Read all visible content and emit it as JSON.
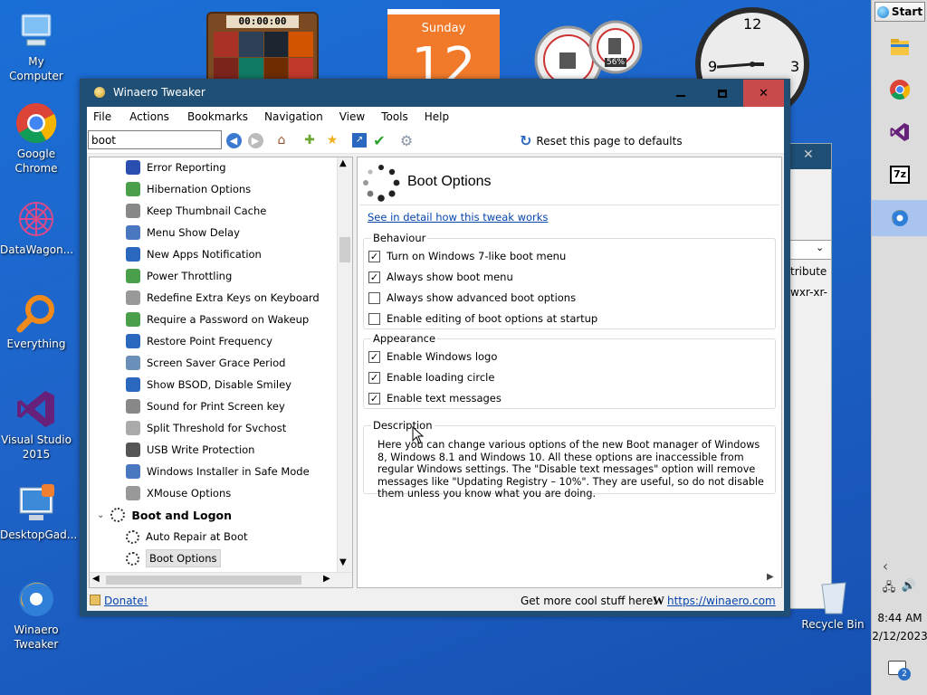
{
  "desktop": {
    "icons": [
      {
        "label": "My Computer"
      },
      {
        "label": "Google Chrome"
      },
      {
        "label": "DataWagon..."
      },
      {
        "label": "Everything"
      },
      {
        "label": "Visual Studio 2015"
      },
      {
        "label": "DesktopGad..."
      },
      {
        "label": "Winaero Tweaker"
      }
    ],
    "recycle_bin": "Recycle Bin"
  },
  "gadgets": {
    "puzzle_timer": "00:00:00",
    "calendar_day": "Sunday",
    "calendar_date": "12",
    "meter_percent": "56%",
    "clock_numbers": [
      "12",
      "3",
      "9"
    ]
  },
  "taskbar": {
    "start_label": "Start",
    "time": "8:44 AM",
    "date": "2/12/2023",
    "notification_count": "2"
  },
  "background_window": {
    "text1": "tribute",
    "text2": "wxr-xr-"
  },
  "window": {
    "title": "Winaero Tweaker",
    "menu": [
      "File",
      "Actions",
      "Bookmarks",
      "Navigation",
      "View",
      "Tools",
      "Help"
    ],
    "search_value": "boot",
    "reset_label": "Reset this page to defaults",
    "tree_items": [
      "Error Reporting",
      "Hibernation Options",
      "Keep Thumbnail Cache",
      "Menu Show Delay",
      "New Apps Notification",
      "Power Throttling",
      "Redefine Extra Keys on Keyboard",
      "Require a Password on Wakeup",
      "Restore Point Frequency",
      "Screen Saver Grace Period",
      "Show BSOD, Disable Smiley",
      "Sound for Print Screen key",
      "Split Threshold for Svchost",
      "USB Write Protection",
      "Windows Installer in Safe Mode",
      "XMouse Options"
    ],
    "tree_category": "Boot and Logon",
    "tree_children": [
      "Auto Repair at Boot",
      "Boot Options"
    ],
    "panel": {
      "title": "Boot Options",
      "link": "See in detail how this tweak works",
      "behaviour_label": "Behaviour",
      "behaviour": [
        {
          "label": "Turn on Windows 7-like boot menu",
          "checked": true
        },
        {
          "label": "Always show boot menu",
          "checked": true
        },
        {
          "label": "Always show advanced boot options",
          "checked": false
        },
        {
          "label": "Enable editing of boot options at startup",
          "checked": false
        }
      ],
      "appearance_label": "Appearance",
      "appearance": [
        {
          "label": "Enable Windows logo",
          "checked": true
        },
        {
          "label": "Enable loading circle",
          "checked": true
        },
        {
          "label": "Enable text messages",
          "checked": true
        }
      ],
      "description_label": "Description",
      "description": "Here you can change various options of the new Boot manager of Windows 8, Windows 8.1 and Windows 10. All these options are inaccessible from regular Windows settings. The \"Disable text messages\" option will remove messages like \"Updating Registry – 10%\". They are useful, so do not disable them unless you know what you are doing."
    },
    "status": {
      "donate": "Donate!",
      "promo": "Get more cool stuff here:",
      "url": "https://winaero.com"
    }
  },
  "colors": {
    "desktop": "#1e63c8",
    "titlebar": "#1f4f75",
    "close": "#c94a4a",
    "link": "#0645ad"
  }
}
